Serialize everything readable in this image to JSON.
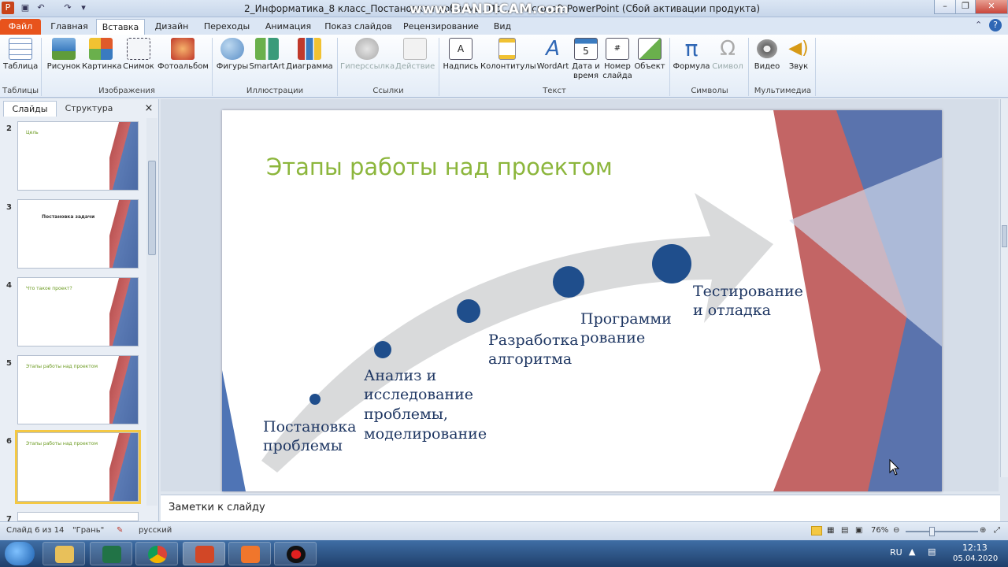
{
  "window": {
    "title": "2_Информатика_8 класс_Постановка проблемы. Пр...  – Microsoft PowerPoint (Сбой активации продукта)",
    "watermark": "www.BANDICAM.com"
  },
  "tabs": [
    "Файл",
    "Главная",
    "Вставка",
    "Дизайн",
    "Переходы",
    "Анимация",
    "Показ слайдов",
    "Рецензирование",
    "Вид"
  ],
  "ribbon": {
    "buttons": [
      {
        "label": "Таблица",
        "group": "tables"
      },
      {
        "label": "Рисунок"
      },
      {
        "label": "Картинка"
      },
      {
        "label": "Снимок"
      },
      {
        "label": "Фотоальбом"
      },
      {
        "label": "Фигуры"
      },
      {
        "label": "SmartArt"
      },
      {
        "label": "Диаграмма"
      },
      {
        "label": "Гиперссылка"
      },
      {
        "label": "Действие"
      },
      {
        "label": "Надпись"
      },
      {
        "label": "Колонтитулы"
      },
      {
        "label": "WordArt"
      },
      {
        "label": "Дата и время"
      },
      {
        "label": "Номер слайда"
      },
      {
        "label": "Объект"
      },
      {
        "label": "Формула"
      },
      {
        "label": "Символ"
      },
      {
        "label": "Видео"
      },
      {
        "label": "Звук"
      }
    ],
    "groups": [
      "Таблицы",
      "Изображения",
      "Иллюстрации",
      "Ссылки",
      "Текст",
      "Символы",
      "Мультимедиа"
    ]
  },
  "panel": {
    "tab_slides": "Слайды",
    "tab_outline": "Структура",
    "close": "×"
  },
  "thumbs": [
    {
      "num": "2",
      "title": "Цель"
    },
    {
      "num": "3",
      "title": "Постановка задачи"
    },
    {
      "num": "4",
      "title": "Что такое проект?"
    },
    {
      "num": "5",
      "title": "Этапы работы над проектом"
    },
    {
      "num": "6",
      "title": "Этапы работы над проектом"
    },
    {
      "num": "7",
      "title": ""
    }
  ],
  "slide": {
    "title": "Этапы работы над проектом",
    "stages": [
      [
        "Постановка",
        "проблемы"
      ],
      [
        "Анализ и",
        "исследование",
        "проблемы,",
        "моделирование"
      ],
      [
        "Разработка",
        "алгоритма"
      ],
      [
        "Программи",
        "рование"
      ],
      [
        "Тестирование",
        "и отладка"
      ]
    ],
    "colors": {
      "title": "#8cb63c",
      "dots": "#1f4e8c",
      "text": "#1f3763",
      "arrow": "#d9dadb"
    }
  },
  "notes": {
    "placeholder": "Заметки к слайду"
  },
  "status": {
    "slide": "Слайд 6 из 14",
    "theme": "\"Грань\"",
    "lang": "русский",
    "zoom": "76%"
  },
  "taskbar": {
    "lang": "RU",
    "time": "12:13",
    "date": "05.04.2020"
  }
}
